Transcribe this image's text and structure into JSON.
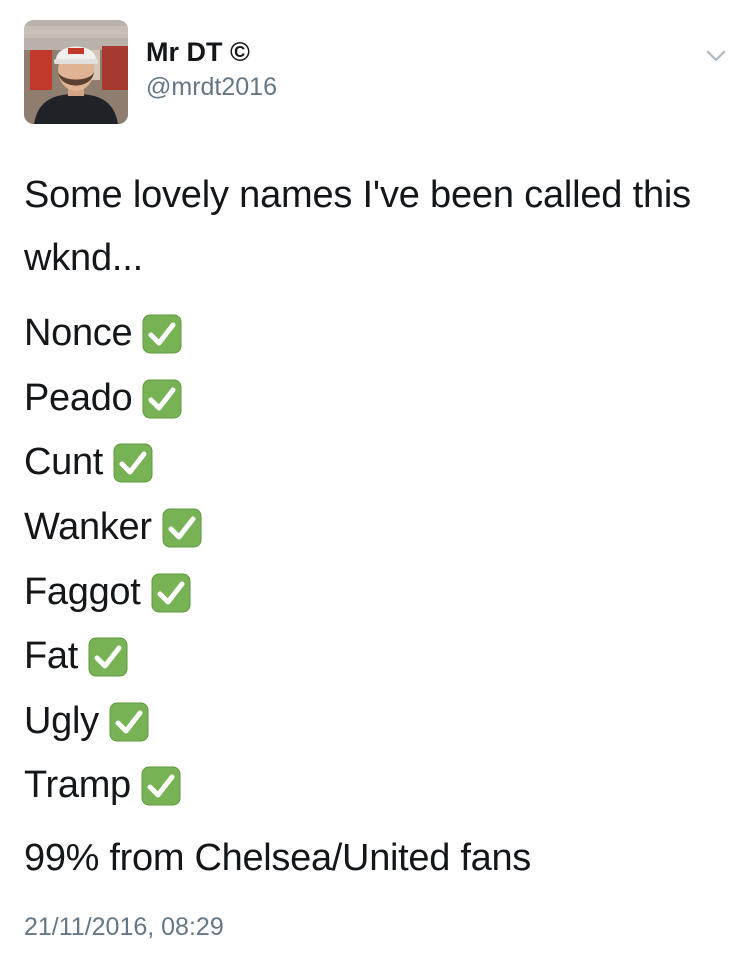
{
  "author": {
    "display_name": "Mr DT ©",
    "username": "@mrdt2016"
  },
  "tweet": {
    "intro": "Some lovely names I've been called this wknd...",
    "names": [
      {
        "label": "Nonce",
        "icon": "check-mark-button-emoji"
      },
      {
        "label": "Peado",
        "icon": "check-mark-button-emoji"
      },
      {
        "label": "Cunt",
        "icon": "check-mark-button-emoji"
      },
      {
        "label": "Wanker",
        "icon": "check-mark-button-emoji"
      },
      {
        "label": "Faggot",
        "icon": "check-mark-button-emoji"
      },
      {
        "label": "Fat",
        "icon": "check-mark-button-emoji"
      },
      {
        "label": "Ugly",
        "icon": "check-mark-button-emoji"
      },
      {
        "label": "Tramp",
        "icon": "check-mark-button-emoji"
      }
    ],
    "closing": "99% from Chelsea/United fans",
    "timestamp": "21/11/2016, 08:29"
  },
  "colors": {
    "text": "#14171a",
    "secondary_text": "#657786",
    "check_green": "#77b255",
    "background": "#ffffff"
  }
}
